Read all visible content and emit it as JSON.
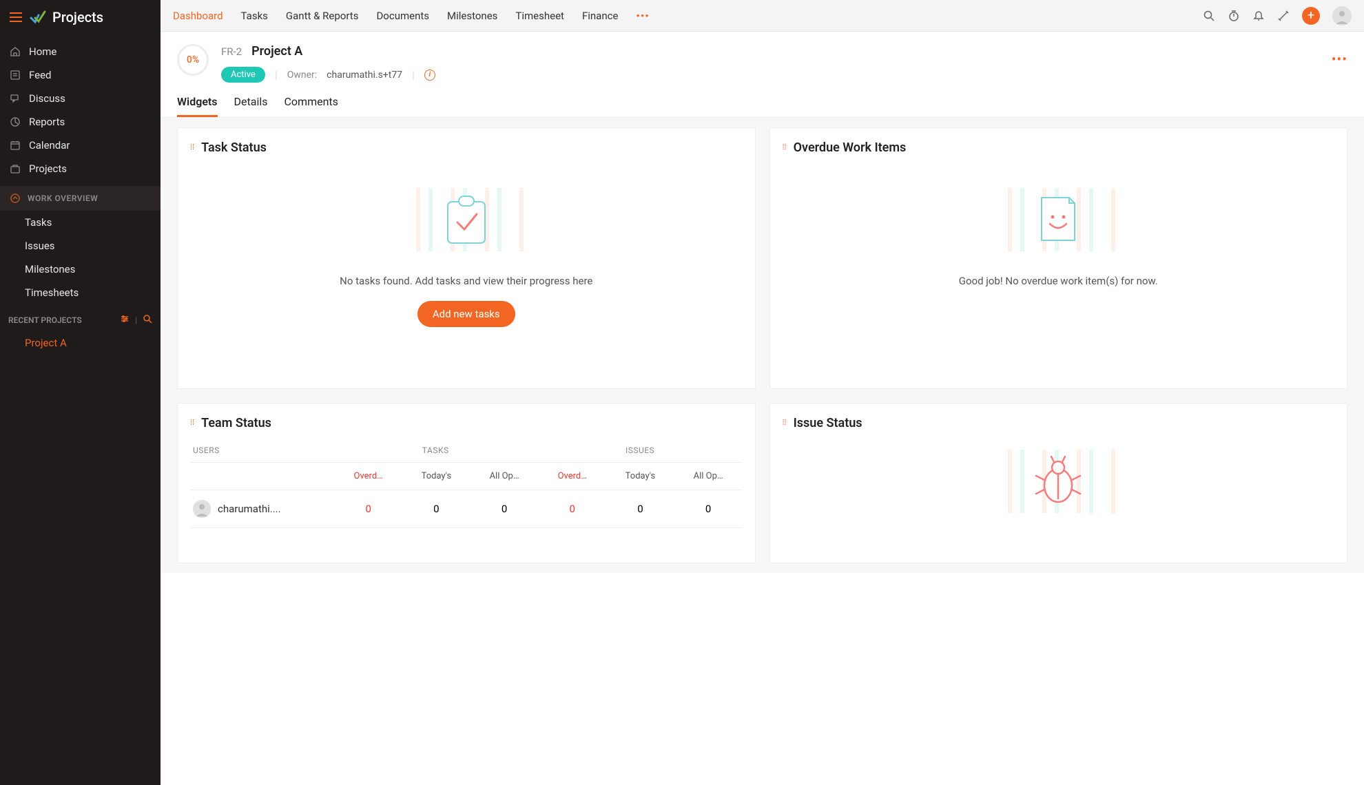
{
  "app": {
    "title": "Projects"
  },
  "sidebar": {
    "nav": [
      {
        "label": "Home"
      },
      {
        "label": "Feed"
      },
      {
        "label": "Discuss"
      },
      {
        "label": "Reports"
      },
      {
        "label": "Calendar"
      },
      {
        "label": "Projects"
      }
    ],
    "workOverview": {
      "title": "WORK OVERVIEW",
      "items": [
        {
          "label": "Tasks"
        },
        {
          "label": "Issues"
        },
        {
          "label": "Milestones"
        },
        {
          "label": "Timesheets"
        }
      ]
    },
    "recent": {
      "title": "RECENT PROJECTS",
      "items": [
        {
          "label": "Project A"
        }
      ]
    }
  },
  "topTabs": [
    {
      "label": "Dashboard",
      "active": true
    },
    {
      "label": "Tasks"
    },
    {
      "label": "Gantt & Reports"
    },
    {
      "label": "Documents"
    },
    {
      "label": "Milestones"
    },
    {
      "label": "Timesheet"
    },
    {
      "label": "Finance"
    }
  ],
  "project": {
    "progress": "0%",
    "code": "FR-2",
    "name": "Project A",
    "status": "Active",
    "ownerLabel": "Owner:",
    "ownerName": "charumathi.s+t77"
  },
  "subtabs": [
    {
      "label": "Widgets",
      "active": true
    },
    {
      "label": "Details"
    },
    {
      "label": "Comments"
    }
  ],
  "widgets": {
    "taskStatus": {
      "title": "Task Status",
      "emptyText": "No tasks found. Add tasks and view their progress here",
      "cta": "Add new tasks"
    },
    "overdue": {
      "title": "Overdue Work Items",
      "emptyText": "Good job! No overdue work item(s) for now."
    },
    "teamStatus": {
      "title": "Team Status",
      "headers": {
        "users": "USERS",
        "tasks": "TASKS",
        "issues": "ISSUES"
      },
      "subHeaders": {
        "overdue": "Overd…",
        "todays": "Today's",
        "allOpen": "All Op…"
      },
      "rows": [
        {
          "user": "charumathi....",
          "t_overdue": "0",
          "t_today": "0",
          "t_open": "0",
          "i_overdue": "0",
          "i_today": "0",
          "i_open": "0"
        }
      ]
    },
    "issueStatus": {
      "title": "Issue Status"
    }
  }
}
